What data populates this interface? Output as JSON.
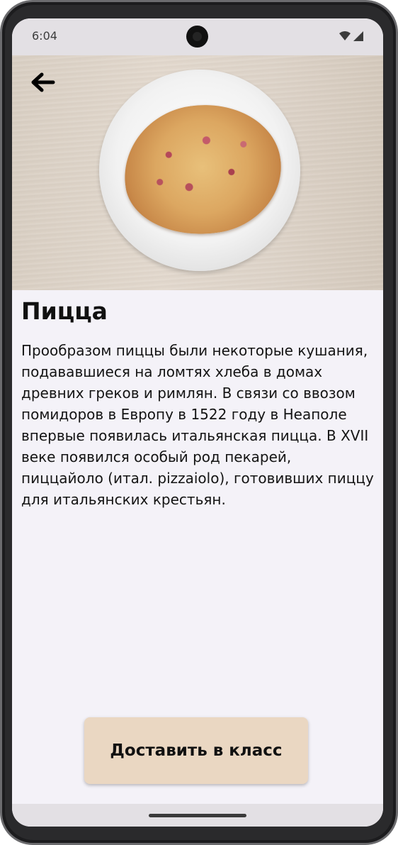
{
  "status_bar": {
    "time": "6:04",
    "icons": [
      "wifi-icon",
      "signal-icon"
    ]
  },
  "header": {
    "back_icon": "arrow-left-icon"
  },
  "hero_image": {
    "subject": "pizza-on-plate"
  },
  "dish": {
    "title": "Пицца",
    "description": "Прообразом пиццы были некоторые кушания, подававшиеся на ломтях хлеба в домах древних греков и римлян. В связи со ввозом помидоров в Европу в 1522 году в Неаполе впервые появилась итальянская пицца. В XVII веке появился особый род пекарей, пиццайоло (итал. pizzaiolo), готовивших пиццу для итальянских крестьян."
  },
  "actions": {
    "deliver_label": "Доставить в класс"
  },
  "colors": {
    "background": "#f4f2f8",
    "button": "#ead7c2",
    "bars": "#e3e0e4"
  }
}
